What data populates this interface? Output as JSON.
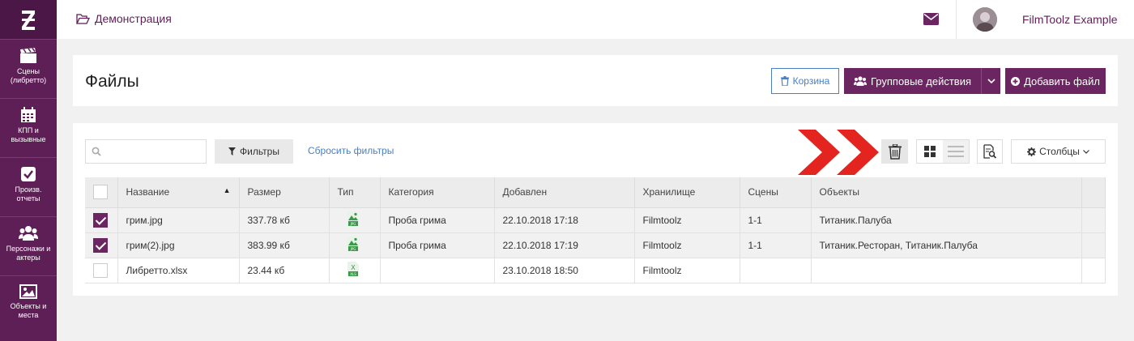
{
  "app": {
    "logo": "Z",
    "breadcrumb": "Демонстрация",
    "user_name": "FilmToolz Example"
  },
  "sidebar": {
    "items": [
      {
        "label": "Сцены\n(либретто)",
        "icon": "clapperboard-icon"
      },
      {
        "label": "КПП и\nвызывные",
        "icon": "calendar-icon"
      },
      {
        "label": "Произв.\nотчеты",
        "icon": "checkbox-icon"
      },
      {
        "label": "Персонажи и\nактеры",
        "icon": "users-icon"
      },
      {
        "label": "Объекты и\nместа",
        "icon": "image-icon"
      }
    ]
  },
  "header": {
    "title": "Файлы",
    "trash_label": "Корзина",
    "group_actions_label": "Групповые действия",
    "add_file_label": "Добавить файл"
  },
  "toolbar": {
    "search_placeholder": "",
    "filters_label": "Фильтры",
    "reset_label": "Сбросить фильтры",
    "columns_label": "Столбцы"
  },
  "colors": {
    "brand": "#6b2560",
    "sidebar": "#5e1f57",
    "link": "#4a7fc1",
    "annotation_arrow": "#e3241f"
  },
  "table": {
    "headers": [
      "Название",
      "Размер",
      "Тип",
      "Категория",
      "Добавлен",
      "Хранилище",
      "Сцены",
      "Объекты"
    ],
    "rows": [
      {
        "selected": true,
        "name": "грим.jpg",
        "size": "337.78 кб",
        "type": "jpg",
        "category": "Проба грима",
        "added": "22.10.2018 17:18",
        "storage": "Filmtoolz",
        "scenes": "1-1",
        "objects": "Титаник.Палуба"
      },
      {
        "selected": true,
        "name": "грим(2).jpg",
        "size": "383.99 кб",
        "type": "jpg",
        "category": "Проба грима",
        "added": "22.10.2018 17:19",
        "storage": "Filmtoolz",
        "scenes": "1-1",
        "objects": "Титаник.Ресторан, Титаник.Палуба"
      },
      {
        "selected": false,
        "name": "Либретто.xlsx",
        "size": "23.44 кб",
        "type": "xls",
        "category": "",
        "added": "23.10.2018 18:50",
        "storage": "Filmtoolz",
        "scenes": "",
        "objects": ""
      }
    ]
  }
}
